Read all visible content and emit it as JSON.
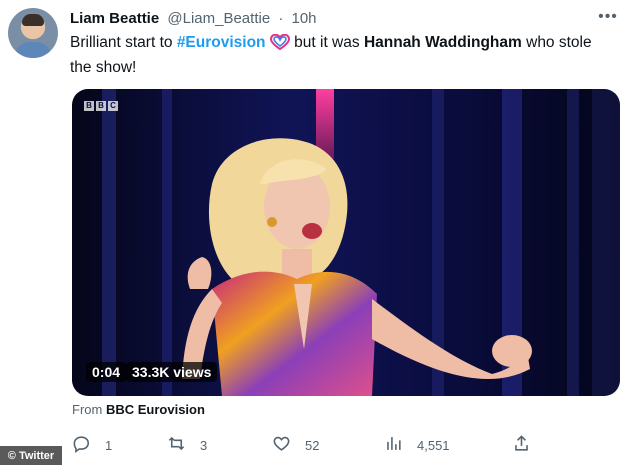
{
  "tweet": {
    "author_name": "Liam Beattie",
    "handle": "@Liam_Beattie",
    "separator": "·",
    "time": "10h",
    "text_parts": {
      "p1": "Brilliant start to ",
      "hashtag": "#Eurovision",
      "p2": " but it was ",
      "bold_name": "Hannah Waddingham",
      "p3": " who stole the show!"
    }
  },
  "video": {
    "bbc_letters": [
      "B",
      "B",
      "C"
    ],
    "duration": "0:04",
    "views": "33.3K views"
  },
  "source": {
    "prefix": "From",
    "name": "BBC Eurovision"
  },
  "actions": {
    "reply_count": "1",
    "retweet_count": "3",
    "like_count": "52",
    "views_count": "4,551"
  },
  "credit": "© Twitter",
  "colors": {
    "accent": "#1d9bf0",
    "text": "#0f1419",
    "muted": "#536471"
  },
  "icons": [
    "more-icon",
    "eurovision-heart-icon",
    "reply-icon",
    "retweet-icon",
    "like-icon",
    "views-icon",
    "share-icon"
  ]
}
